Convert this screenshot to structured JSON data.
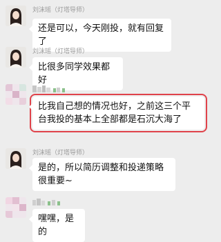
{
  "messages": [
    {
      "sender": "刘沫瑶（灯塔导师）",
      "text": "还是可以，今天刚投，就有回复了"
    },
    {
      "sender": "刘沫瑶（灯塔导师）",
      "text": "比很多同学效果都好"
    },
    {
      "sender": "",
      "text": "比我自己想的情况也好，之前这三个平台我投的基本上全部都是石沉大海了"
    },
    {
      "sender": "刘沫瑶（灯塔导师）",
      "text": "是的，所以简历调整和投递策略很重要~"
    },
    {
      "sender": "",
      "text": "嘿嘿，是的"
    }
  ],
  "colors": {
    "background": "#ededed",
    "bubble": "#ffffff",
    "highlight": "#e0424a",
    "sender_text": "#9a9a9a"
  }
}
